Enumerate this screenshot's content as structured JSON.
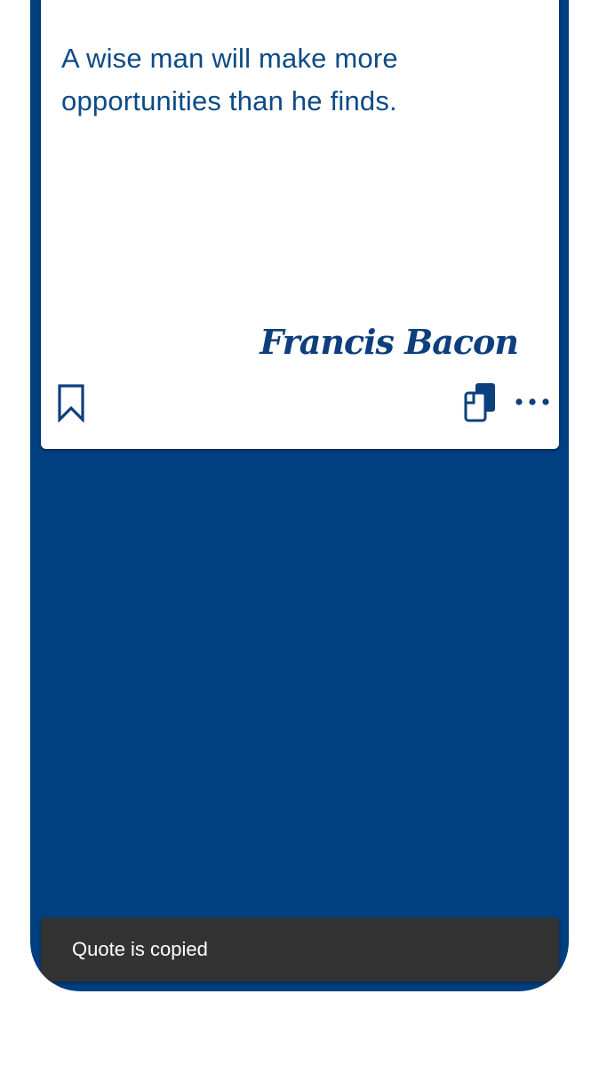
{
  "quote": {
    "text": "A wise man will make more opportunities than he finds.",
    "author": "Francis Bacon"
  },
  "actions": {
    "bookmark_icon": "bookmark-outline-icon",
    "copy_icon": "copy-icon",
    "more_icon": "more-horizontal-icon"
  },
  "snackbar": {
    "message": "Quote is copied"
  },
  "colors": {
    "background": "#003f80",
    "card": "#ffffff",
    "quote_text": "#0d4a86",
    "snackbar": "#333333"
  }
}
